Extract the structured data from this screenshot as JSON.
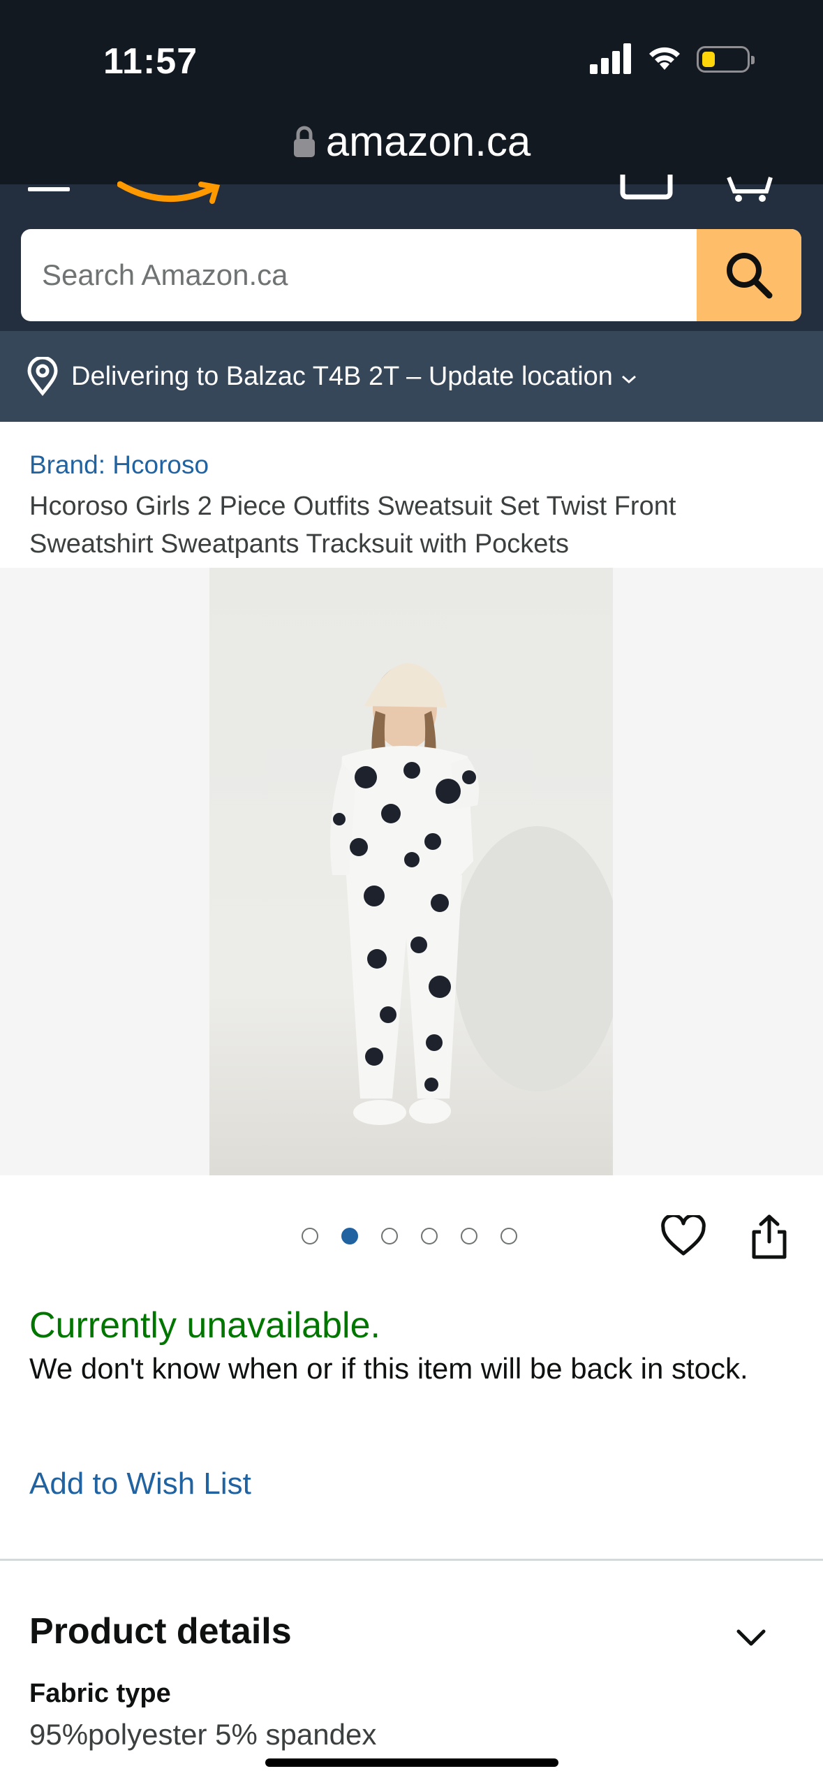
{
  "status_bar": {
    "time": "11:57"
  },
  "browser": {
    "url": "amazon.ca"
  },
  "search": {
    "placeholder": "Search Amazon.ca"
  },
  "delivery": {
    "text": "Delivering to Balzac T4B 2T – Update location"
  },
  "product": {
    "brand": "Brand: Hcoroso",
    "title": "Hcoroso Girls 2 Piece Outfits Sweatsuit Set Twist Front Sweatshirt Sweatpants Tracksuit with Pockets"
  },
  "carousel": {
    "count": 6,
    "active_index": 1
  },
  "availability": {
    "status": "Currently unavailable.",
    "message": "We don't know when or if this item will be back in stock.",
    "wishlist_label": "Add to Wish List"
  },
  "product_details": {
    "heading": "Product details",
    "rows": [
      {
        "label": "Fabric type",
        "value": "95%polyester 5% spandex"
      }
    ]
  },
  "colors": {
    "header_dark": "#131921",
    "header_nav": "#232f3e",
    "delivery_bar": "#37475a",
    "search_button": "#febd69",
    "link": "#2162a1",
    "unavailable": "#007600",
    "logo_orange": "#ff9900"
  },
  "icons": [
    "lock-icon",
    "menu-icon",
    "amazon-smile-logo",
    "account-icon",
    "cart-icon",
    "search-icon",
    "location-pin-icon",
    "chevron-down-icon",
    "heart-icon",
    "share-icon"
  ]
}
